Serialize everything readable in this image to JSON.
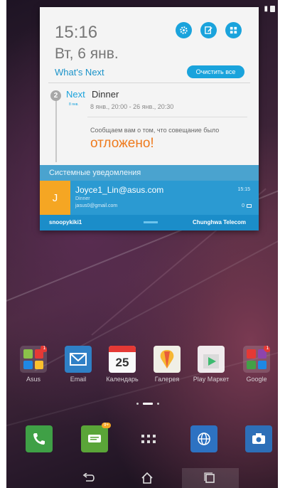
{
  "notification_panel": {
    "time": "15:16",
    "date": "Вт, 6 янв.",
    "whats_next_label": "What's Next",
    "clear_all_label": "Очистить все",
    "event": {
      "count_badge": "2",
      "next_label": "Next",
      "title": "Dinner",
      "date_small": "8 янв.",
      "date_range": "8 янв., 20:00 - 26 янв., 20:30",
      "message": "Сообщаем вам о том, что совещание было",
      "status": "отложено!"
    },
    "system_notifications_label": "Системные уведомления",
    "email": {
      "avatar_letter": "J",
      "sender": "Joyce1_Lin@asus.com",
      "subject": "Dinner",
      "account": "jasus0@gmail.com",
      "time": "15:15",
      "count": "0"
    },
    "carrier": {
      "left": "snoopykiki1",
      "right": "Chunghwa Telecom"
    }
  },
  "home_apps": [
    {
      "label": "Asus",
      "icon": "asus-folder-icon",
      "badge": "1"
    },
    {
      "label": "Email",
      "icon": "email-icon"
    },
    {
      "label": "Календарь",
      "icon": "calendar-icon",
      "calendar_day": "25"
    },
    {
      "label": "Галерея",
      "icon": "gallery-icon"
    },
    {
      "label": "Play Маркет",
      "icon": "play-store-icon"
    },
    {
      "label": "Google",
      "icon": "google-folder-icon",
      "badge": "1"
    }
  ],
  "dock": [
    {
      "icon": "phone-icon"
    },
    {
      "icon": "messages-icon",
      "badge": "9+"
    },
    {
      "icon": "all-apps-icon"
    },
    {
      "icon": "browser-icon"
    },
    {
      "icon": "camera-icon"
    }
  ],
  "colors": {
    "accent": "#1aa3dc",
    "postponed": "#ee7a1d",
    "avatar": "#f5a623"
  }
}
